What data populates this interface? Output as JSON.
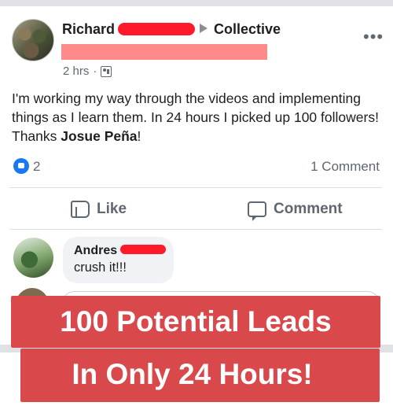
{
  "post": {
    "author_first_name": "Richard",
    "group_name": "Collective",
    "time": "2 hrs",
    "separator": "·",
    "text_main": "I'm working my way through the videos and implementing things as I learn them. In 24 hours I picked up 100 followers! Thanks ",
    "text_tag": "Josue Peña",
    "text_end": "!",
    "reaction_count": "2",
    "comment_count_label": "1 Comment",
    "more_label": "•••"
  },
  "actions": {
    "like_label": "Like",
    "comment_label": "Comment"
  },
  "comment": {
    "author_first_name": "Andres",
    "text": "crush it!!!"
  },
  "overlay": {
    "line1": "100 Potential Leads",
    "line2": "In Only 24 Hours!"
  },
  "icons": {
    "reaction": "like-reaction-icon",
    "like": "thumbs-up-icon",
    "comment": "comment-bubble-icon",
    "audience": "group-audience-icon",
    "arrow": "triangle-right-icon",
    "more": "more-options-icon"
  },
  "colors": {
    "facebook_blue": "#1877f2",
    "redaction": "#ff1a2a",
    "banner": "#d9484a"
  }
}
